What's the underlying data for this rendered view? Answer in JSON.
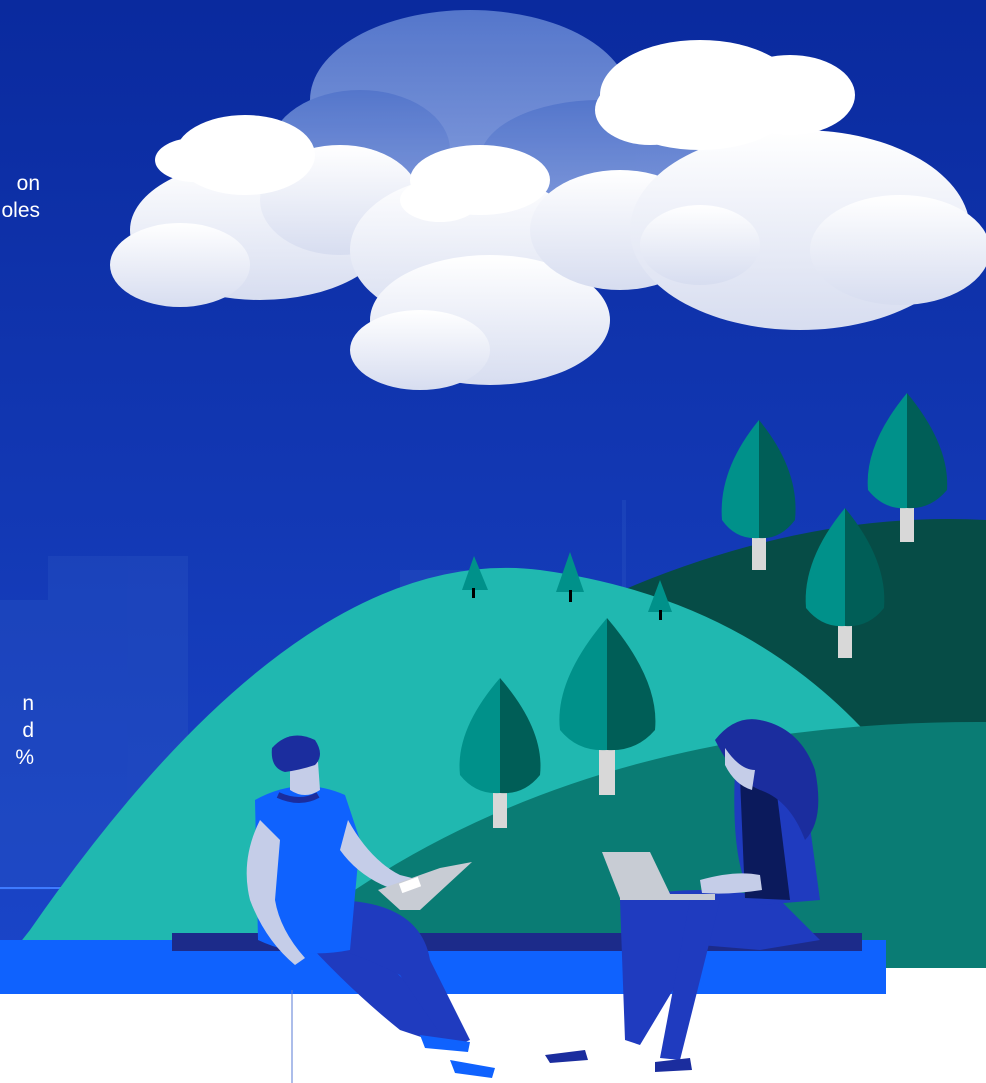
{
  "intro_text": {
    "lines": [
      "on",
      "oles"
    ]
  },
  "stat_text": {
    "lines": [
      "n",
      "d",
      "%"
    ]
  },
  "colors": {
    "sky_top": "#0a2a9e",
    "sky_bottom": "#1a45c8",
    "hill_teal": "#20b8b0",
    "hill_dark": "#064c46",
    "hill_mid": "#0a7c74",
    "tree_light": "#00918a",
    "tree_dark": "#005e57",
    "bench": "#0f62fe",
    "bench_top": "#1c2b8a",
    "person_blue": "#0f62fe",
    "pants": "#1f3bbf",
    "skin": "#c5cde8",
    "hair": "#1b2d9e",
    "laptop": "#c8ccd4"
  },
  "icons": [
    "cloud-icon",
    "tree-icon",
    "person-icon",
    "laptop-icon"
  ]
}
